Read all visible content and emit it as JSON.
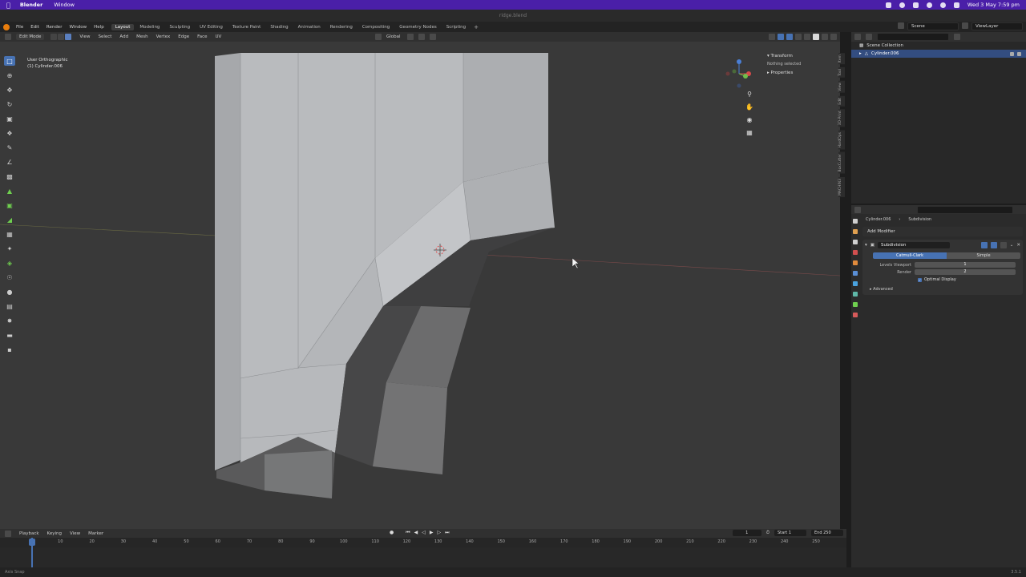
{
  "mac_menubar": {
    "app": "Blender",
    "items": [
      "Window"
    ],
    "clock": "Wed 3 May  7:59 pm"
  },
  "window": {
    "title": "ridge.blend"
  },
  "topbar": {
    "menus": [
      "File",
      "Edit",
      "Render",
      "Window",
      "Help"
    ],
    "workspaces": [
      "Layout",
      "Modeling",
      "Sculpting",
      "UV Editing",
      "Texture Paint",
      "Shading",
      "Animation",
      "Rendering",
      "Compositing",
      "Geometry Nodes",
      "Scripting"
    ],
    "active_workspace": "Layout",
    "scene": "Scene",
    "view_layer": "ViewLayer"
  },
  "viewport_header": {
    "mode": "Edit Mode",
    "menus": [
      "View",
      "Select",
      "Add",
      "Mesh",
      "Vertex",
      "Edge",
      "Face",
      "UV"
    ],
    "orientation": "Global",
    "axes": [
      "X",
      "Y",
      "Z"
    ],
    "options": "Options"
  },
  "viewport": {
    "view_name": "User Orthographic",
    "object_label": "(1) Cylinder.006",
    "tools": [
      "select-box",
      "cursor",
      "move",
      "rotate",
      "scale",
      "transform",
      "annotate",
      "measure",
      "add-cube",
      "extrude",
      "inset",
      "bevel",
      "loop-cut",
      "knife",
      "poly-build",
      "spin",
      "smooth",
      "edge-slide",
      "shrink-fatten",
      "shear",
      "rip"
    ]
  },
  "npanel": {
    "transform_label": "Transform",
    "nothing_selected": "Nothing selected",
    "properties_label": "Properties",
    "tabs": [
      "Item",
      "Tool",
      "View",
      "Edit",
      "3D-Print",
      "HardOps",
      "BoxCutter",
      "MACHIN3"
    ]
  },
  "outliner": {
    "collection": "Scene Collection",
    "object": "Cylinder.006"
  },
  "properties": {
    "object": "Cylinder.006",
    "modifier": "Subdivision",
    "add_modifier": "Add Modifier",
    "modifier_name": "Subdivision",
    "subdiv_types": [
      "Catmull-Clark",
      "Simple"
    ],
    "levels_viewport_label": "Levels Viewport",
    "levels_viewport": "1",
    "render_label": "Render",
    "render_value": "2",
    "optimal_display": "Optimal Display",
    "advanced": "Advanced",
    "tab_colors": [
      "#cfcfcf",
      "#e0a050",
      "#cfcfcf",
      "#d14f4f",
      "#e08a3c",
      "#5a8fd6",
      "#4aa3df",
      "#5fb8a8",
      "#6fcf4f",
      "#d65a5a"
    ]
  },
  "timeline": {
    "menus": [
      "Playback",
      "Keying",
      "View",
      "Marker"
    ],
    "current_frame": "1",
    "start_label": "Start",
    "start": "1",
    "end_label": "End",
    "end": "250",
    "ticks": [
      "1",
      "10",
      "20",
      "30",
      "40",
      "50",
      "60",
      "70",
      "80",
      "90",
      "100",
      "110",
      "120",
      "130",
      "140",
      "150",
      "160",
      "170",
      "180",
      "190",
      "200",
      "210",
      "220",
      "230",
      "240",
      "250"
    ]
  },
  "statusbar": {
    "left": "Axis Snap",
    "version": "3.5.1"
  },
  "colors": {
    "accent": "#4772b3",
    "menubar": "#4a1fa8",
    "viewport_bg": "#393939"
  }
}
